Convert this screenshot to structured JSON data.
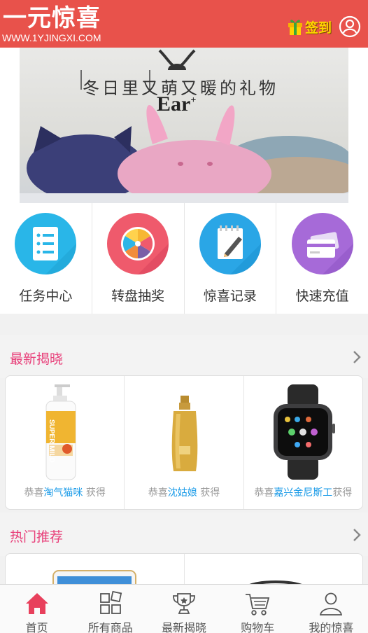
{
  "header": {
    "logo_text": "一元惊喜",
    "logo_url": "WWW.1YJINGXI.COM",
    "signin_label": "签到"
  },
  "banner": {
    "headline": "冬日里又萌又暖的礼物",
    "brand": "Ear",
    "brand_mark": "+"
  },
  "quick_menu": [
    {
      "label": "任务中心",
      "icon": "task-list-icon",
      "color": "#29b6e8"
    },
    {
      "label": "转盘抽奖",
      "icon": "lucky-wheel-icon",
      "color": "#ef5a6c"
    },
    {
      "label": "惊喜记录",
      "icon": "notepad-pencil-icon",
      "color": "#2aa6e6"
    },
    {
      "label": "快速充值",
      "icon": "credit-card-icon",
      "color": "#a66ad8"
    }
  ],
  "latest": {
    "title": "最新揭晓",
    "items": [
      {
        "prefix": "恭喜",
        "winner": "淘气猫咪",
        "suffix": "获得",
        "product_icon": "shampoo-bottle-image",
        "product_label": "SUPER MILD"
      },
      {
        "prefix": "恭喜",
        "winner": "沈姑娘",
        "suffix": "获得",
        "product_icon": "gold-shampoo-bottle-image"
      },
      {
        "prefix": "恭喜",
        "winner": "嘉兴金尼斯工",
        "suffix": "获得",
        "product_icon": "smartwatch-image"
      }
    ]
  },
  "hot": {
    "title": "热门推荐"
  },
  "tabbar": [
    {
      "label": "首页",
      "icon": "home-icon",
      "active": true
    },
    {
      "label": "所有商品",
      "icon": "grid-icon",
      "active": false
    },
    {
      "label": "最新揭晓",
      "icon": "trophy-icon",
      "active": false
    },
    {
      "label": "购物车",
      "icon": "cart-icon",
      "active": false
    },
    {
      "label": "我的惊喜",
      "icon": "user-icon",
      "active": false
    }
  ],
  "colors": {
    "header_bg": "#e8524b",
    "section_title": "#e8407a",
    "winner_name": "#1a9be8",
    "active_tab": "#e8405c"
  }
}
